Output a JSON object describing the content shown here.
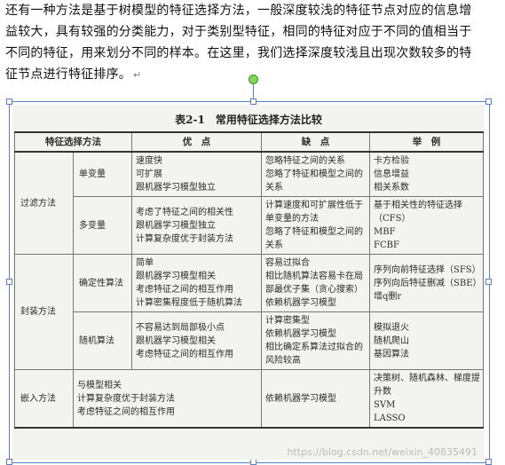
{
  "paragraph": {
    "lines": [
      "还有一种方法是基于树模型的特征选择方法，一般深度较浅的特征节点对应的信息增",
      "益较大，具有较强的分类能力，对于类别型特征，相同的特征对应于不同的值相当于",
      "不同的特征，用来划分不同的样本。在这里，我们选择深度较浅且出现次数较多的特",
      "征节点进行特征排序。"
    ],
    "return_mark": "↵"
  },
  "figure": {
    "caption_number": "表2-1",
    "caption_title": "常用特征选择方法比较",
    "headers": [
      "特征选择方法",
      "优　点",
      "缺　点",
      "举　例"
    ],
    "groups": [
      {
        "category": "过滤方法",
        "rows": [
          {
            "method": "单变量",
            "pros": [
              "速度快",
              "可扩展",
              "跟机器学习模型独立"
            ],
            "cons": [
              "忽略特征之间的关系",
              "忽略了特征和模型之间的",
              "关系"
            ],
            "examples": [
              "卡方检验",
              "信息增益",
              "相关系数"
            ]
          },
          {
            "method": "多变量",
            "pros": [
              "考虑了特征之间的相关性",
              "跟机器学习模型独立",
              "计算复杂度优于封装方法"
            ],
            "cons": [
              "计算速度和可扩展性低于",
              "单变量的方法",
              "忽略了特征和模型之间的",
              "关系"
            ],
            "examples": [
              "基于相关性的特征选择",
              "（CFS）",
              "MBF",
              "FCBF"
            ]
          }
        ]
      },
      {
        "category": "封装方法",
        "rows": [
          {
            "method": "确定性算法",
            "pros": [
              "简单",
              "跟机器学习模型相关",
              "考虑特征之间的相互作用",
              "计算密集程度低于随机算法"
            ],
            "cons": [
              "容易过拟合",
              "相比随机算法容易卡在局",
              "部最优子集（贪心搜索）",
              "依赖机器学习模型"
            ],
            "examples": [
              "序列向前特征选择（SFS）",
              "序列向后特征删减（SBE）",
              "增q删r"
            ]
          },
          {
            "method": "随机算法",
            "pros": [
              "不容易达到局部极小点",
              "跟机器学习模型相关",
              "考虑特征之间的相互作用"
            ],
            "cons": [
              "计算密集型",
              "依赖机器学习模型",
              "相比确定系算法过拟合的",
              "风险较高"
            ],
            "examples": [
              "模拟退火",
              "随机爬山",
              "基因算法"
            ]
          }
        ]
      },
      {
        "category": "嵌入方法",
        "rows": [
          {
            "method": "",
            "pros": [
              "与模型相关",
              "计算复杂度优于封装方法",
              "考虑特征之间的相互作用"
            ],
            "cons": [
              "依赖机器学习模型"
            ],
            "examples": [
              "决策树、随机森林、梯度提",
              "升数",
              "SVM",
              "LASSO"
            ]
          }
        ]
      }
    ],
    "watermark": "https://blog.csdn.net/weixin_40835491"
  }
}
